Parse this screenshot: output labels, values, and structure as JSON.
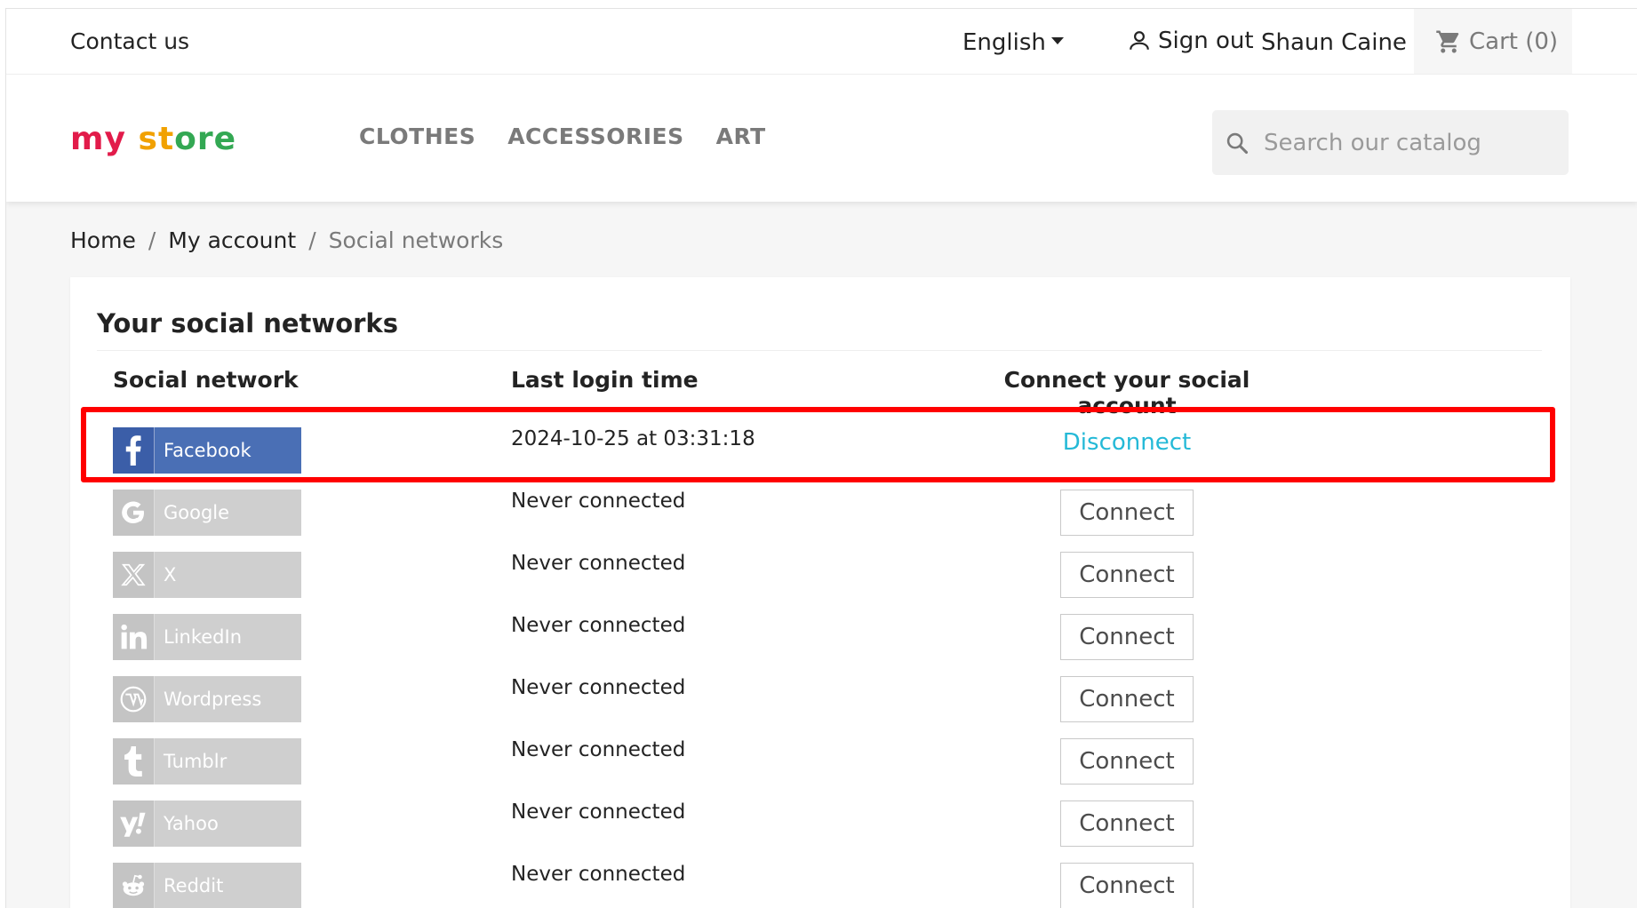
{
  "topnav": {
    "contact": "Contact us",
    "language": "English",
    "signout": "Sign out",
    "user": "Shaun Caine",
    "cart": "Cart (0)"
  },
  "header": {
    "logo_parts": [
      "my",
      " ",
      "st",
      "ore"
    ],
    "menu": [
      "CLOTHES",
      "ACCESSORIES",
      "ART"
    ],
    "search_placeholder": "Search our catalog"
  },
  "breadcrumb": {
    "home": "Home",
    "account": "My account",
    "current": "Social networks",
    "separator": "/"
  },
  "card": {
    "title": "Your social networks",
    "columns": [
      "Social network",
      "Last login time",
      "Connect your social account"
    ]
  },
  "networks": [
    {
      "name": "Facebook",
      "icon": "facebook-icon",
      "time": "2024-10-25 at 03:31:18",
      "action": "Disconnect",
      "connected": true
    },
    {
      "name": "Google",
      "icon": "google-icon",
      "time": "Never connected",
      "action": "Connect",
      "connected": false
    },
    {
      "name": "X",
      "icon": "x-icon",
      "time": "Never connected",
      "action": "Connect",
      "connected": false
    },
    {
      "name": "LinkedIn",
      "icon": "linkedin-icon",
      "time": "Never connected",
      "action": "Connect",
      "connected": false
    },
    {
      "name": "Wordpress",
      "icon": "wordpress-icon",
      "time": "Never connected",
      "action": "Connect",
      "connected": false
    },
    {
      "name": "Tumblr",
      "icon": "tumblr-icon",
      "time": "Never connected",
      "action": "Connect",
      "connected": false
    },
    {
      "name": "Yahoo",
      "icon": "yahoo-icon",
      "time": "Never connected",
      "action": "Connect",
      "connected": false
    },
    {
      "name": "Reddit",
      "icon": "reddit-icon",
      "time": "Never connected",
      "action": "Connect",
      "connected": false
    }
  ],
  "colors": {
    "accent_link": "#24b9d7",
    "facebook": "#4a6fb5",
    "inactive_badge": "#cfcfcf",
    "highlight": "#ff0000"
  }
}
